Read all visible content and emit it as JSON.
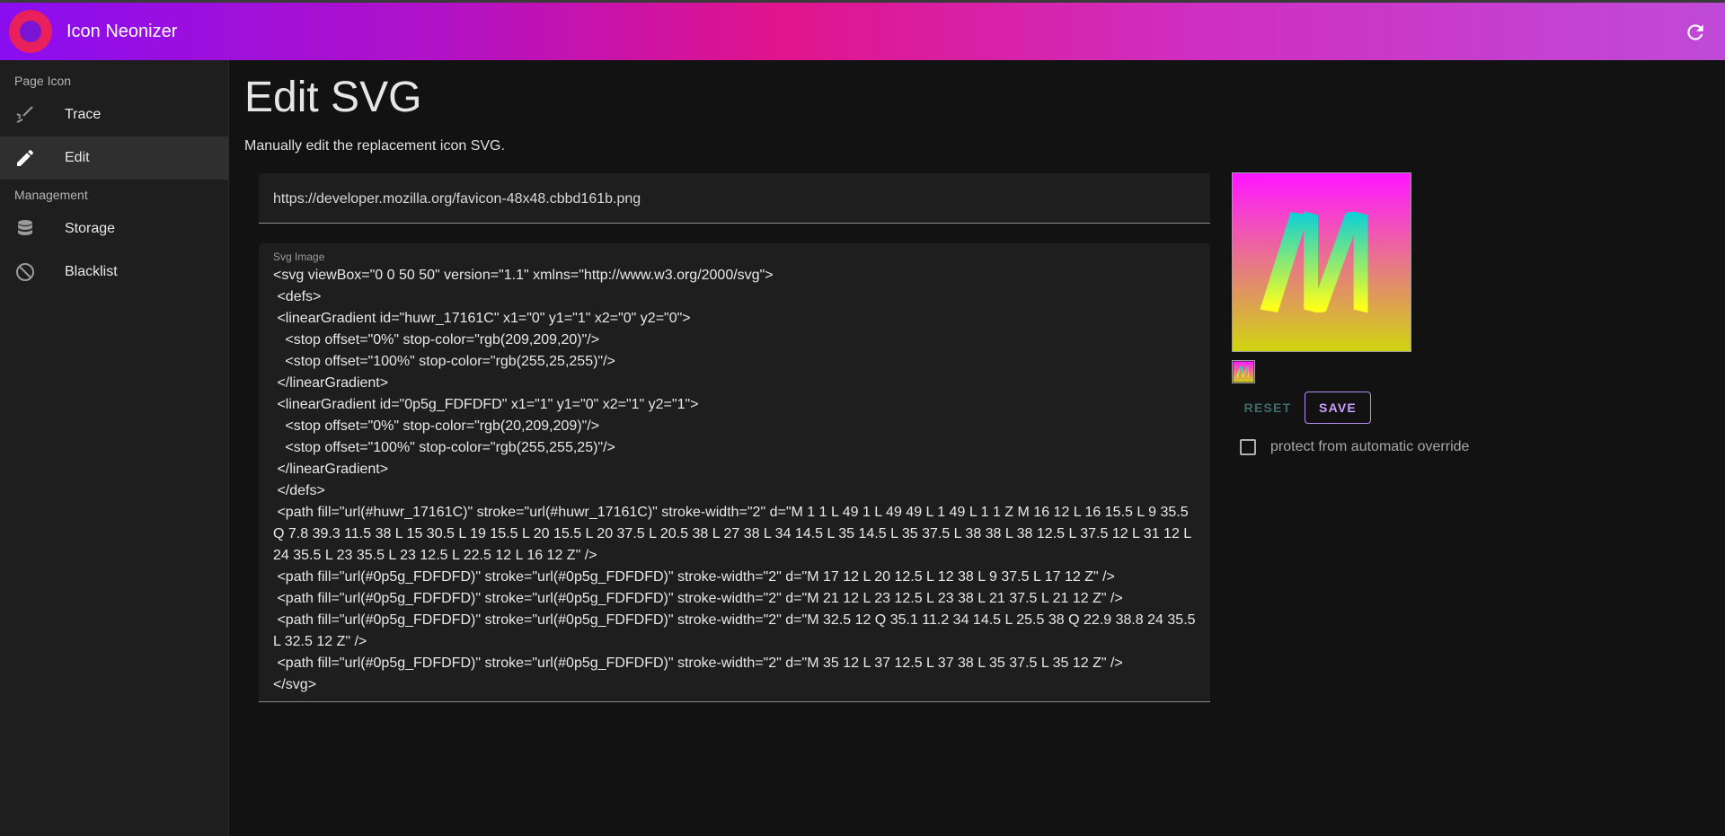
{
  "app": {
    "title": "Icon Neonizer"
  },
  "sidebar": {
    "sections": [
      {
        "label": "Page Icon",
        "items": [
          {
            "label": "Trace",
            "icon": "trace-brush-icon"
          },
          {
            "label": "Edit",
            "icon": "pencil-icon",
            "active": true
          }
        ]
      },
      {
        "label": "Management",
        "items": [
          {
            "label": "Storage",
            "icon": "database-icon"
          },
          {
            "label": "Blacklist",
            "icon": "block-icon"
          }
        ]
      }
    ]
  },
  "main": {
    "title": "Edit SVG",
    "description": "Manually edit the replacement icon SVG.",
    "url_value": "https://developer.mozilla.org/favicon-48x48.cbbd161b.png",
    "svg_label": "Svg Image",
    "svg_value": "<svg viewBox=\"0 0 50 50\" version=\"1.1\" xmlns=\"http://www.w3.org/2000/svg\">\n <defs>\n <linearGradient id=\"huwr_17161C\" x1=\"0\" y1=\"1\" x2=\"0\" y2=\"0\">\n   <stop offset=\"0%\" stop-color=\"rgb(209,209,20)\"/>\n   <stop offset=\"100%\" stop-color=\"rgb(255,25,255)\"/>\n </linearGradient>\n <linearGradient id=\"0p5g_FDFDFD\" x1=\"1\" y1=\"0\" x2=\"1\" y2=\"1\">\n   <stop offset=\"0%\" stop-color=\"rgb(20,209,209)\"/>\n   <stop offset=\"100%\" stop-color=\"rgb(255,255,25)\"/>\n </linearGradient>\n </defs>\n <path fill=\"url(#huwr_17161C)\" stroke=\"url(#huwr_17161C)\" stroke-width=\"2\" d=\"M 1 1 L 49 1 L 49 49 L 1 49 L 1 1 Z M 16 12 L 16 15.5 L 9 35.5 Q 7.8 39.3 11.5 38 L 15 30.5 L 19 15.5 L 20 15.5 L 20 37.5 L 20.5 38 L 27 38 L 34 14.5 L 35 14.5 L 35 37.5 L 38 38 L 38 12.5 L 37.5 12 L 31 12 L 24 35.5 L 23 35.5 L 23 12.5 L 22.5 12 L 16 12 Z\" />\n <path fill=\"url(#0p5g_FDFDFD)\" stroke=\"url(#0p5g_FDFDFD)\" stroke-width=\"2\" d=\"M 17 12 L 20 12.5 L 12 38 L 9 37.5 L 17 12 Z\" />\n <path fill=\"url(#0p5g_FDFDFD)\" stroke=\"url(#0p5g_FDFDFD)\" stroke-width=\"2\" d=\"M 21 12 L 23 12.5 L 23 38 L 21 37.5 L 21 12 Z\" />\n <path fill=\"url(#0p5g_FDFDFD)\" stroke=\"url(#0p5g_FDFDFD)\" stroke-width=\"2\" d=\"M 32.5 12 Q 35.1 11.2 34 14.5 L 25.5 38 Q 22.9 38.8 24 35.5 L 32.5 12 Z\" />\n <path fill=\"url(#0p5g_FDFDFD)\" stroke=\"url(#0p5g_FDFDFD)\" stroke-width=\"2\" d=\"M 35 12 L 37 12.5 L 37 38 L 35 37.5 L 35 12 Z\" />\n</svg>",
    "reset_label": "RESET",
    "save_label": "SAVE",
    "protect_label": "protect from automatic override",
    "protect_checked": false
  },
  "colors": {
    "accent": "#c9a0ff",
    "brand_start": "#8a0df0",
    "brand_mid": "#e0148c"
  }
}
